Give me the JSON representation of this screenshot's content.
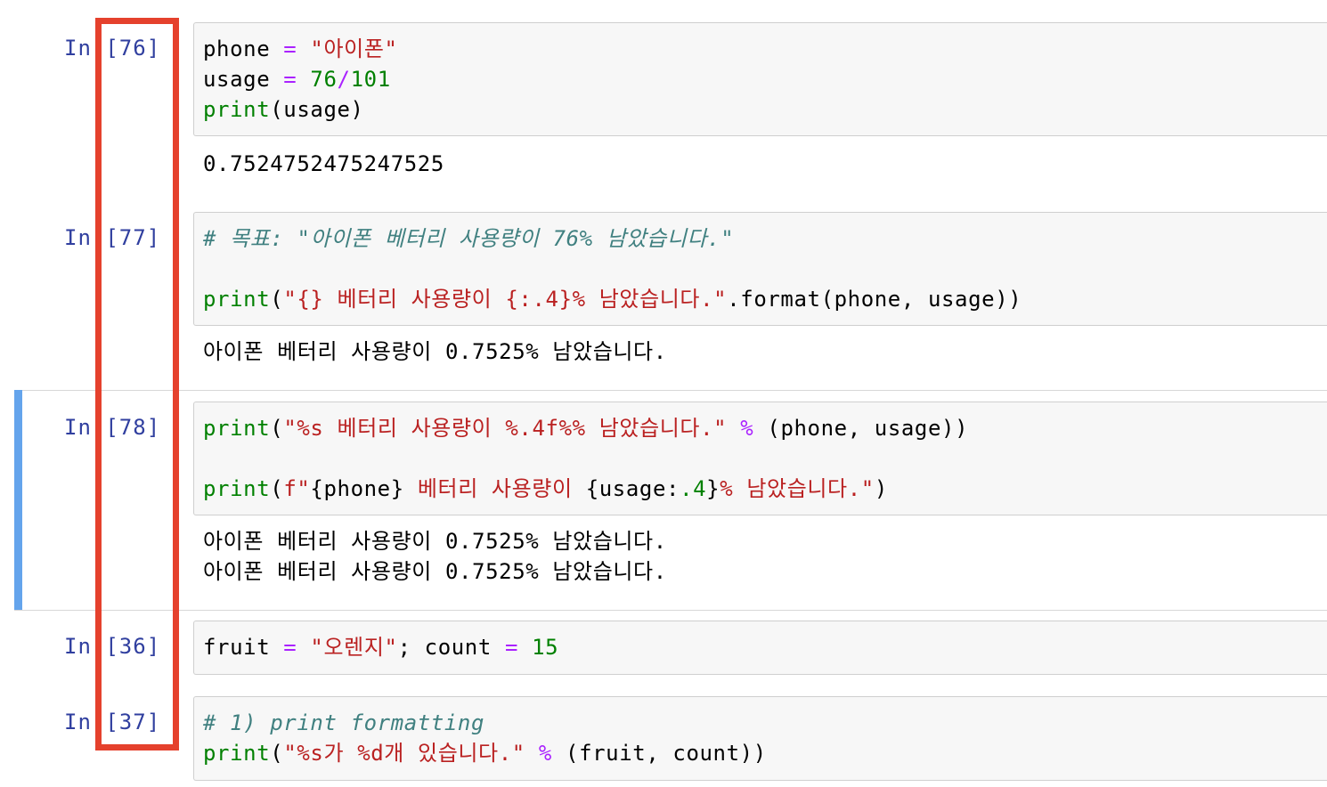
{
  "cells": [
    {
      "prompt": "In [76]",
      "lines": [
        [
          {
            "t": "phone "
          },
          {
            "t": "=",
            "c": "op"
          },
          {
            "t": " "
          },
          {
            "t": "\"아이폰\"",
            "c": "str"
          }
        ],
        [
          {
            "t": "usage "
          },
          {
            "t": "=",
            "c": "op"
          },
          {
            "t": " "
          },
          {
            "t": "76",
            "c": "num"
          },
          {
            "t": "/",
            "c": "op"
          },
          {
            "t": "101",
            "c": "num"
          }
        ],
        [
          {
            "t": "print",
            "c": "kw"
          },
          {
            "t": "(usage)"
          }
        ]
      ],
      "output": [
        "0.7524752475247525"
      ]
    },
    {
      "prompt": "In [77]",
      "lines": [
        [
          {
            "t": "# 목표: \"아이폰 베터리 사용량이 76% 남았습니다.\"",
            "c": "cm"
          }
        ],
        [],
        [
          {
            "t": "print",
            "c": "kw"
          },
          {
            "t": "("
          },
          {
            "t": "\"{} 베터리 사용량이 {:.4}% 남았습니다.\"",
            "c": "str"
          },
          {
            "t": ".format(phone, usage))"
          }
        ]
      ],
      "output": [
        "아이폰 베터리 사용량이 0.7525% 남았습니다."
      ]
    },
    {
      "prompt": "In [78]",
      "lines": [
        [
          {
            "t": "print",
            "c": "kw"
          },
          {
            "t": "("
          },
          {
            "t": "\"%s 베터리 사용량이 %.4f%% 남았습니다.\"",
            "c": "str"
          },
          {
            "t": " "
          },
          {
            "t": "%",
            "c": "op"
          },
          {
            "t": " (phone, usage))"
          }
        ],
        [],
        [
          {
            "t": "print",
            "c": "kw"
          },
          {
            "t": "("
          },
          {
            "t": "f\"",
            "c": "str"
          },
          {
            "t": "{phone}"
          },
          {
            "t": " 베터리 사용량이 ",
            "c": "str"
          },
          {
            "t": "{usage:"
          },
          {
            "t": ".4",
            "c": "num"
          },
          {
            "t": "}"
          },
          {
            "t": "% 남았습니다.\"",
            "c": "str"
          },
          {
            "t": ")"
          }
        ]
      ],
      "output": [
        "아이폰 베터리 사용량이 0.7525% 남았습니다.",
        "아이폰 베터리 사용량이 0.7525% 남았습니다."
      ]
    },
    {
      "prompt": "In [36]",
      "lines": [
        [
          {
            "t": "fruit "
          },
          {
            "t": "=",
            "c": "op"
          },
          {
            "t": " "
          },
          {
            "t": "\"오렌지\"",
            "c": "str"
          },
          {
            "t": "; count "
          },
          {
            "t": "=",
            "c": "op"
          },
          {
            "t": " "
          },
          {
            "t": "15",
            "c": "num"
          }
        ]
      ],
      "output": []
    },
    {
      "prompt": "In [37]",
      "lines": [
        [
          {
            "t": "# 1) print formatting",
            "c": "cm"
          }
        ],
        [
          {
            "t": "print",
            "c": "kw"
          },
          {
            "t": "("
          },
          {
            "t": "\"%s가 %d개 있습니다.\"",
            "c": "str"
          },
          {
            "t": " "
          },
          {
            "t": "%",
            "c": "op"
          },
          {
            "t": " (fruit, count))"
          }
        ]
      ],
      "output": []
    }
  ],
  "colors": {
    "prompt": "#303f9f",
    "keyword": "#008000",
    "operator": "#aa22ff",
    "string": "#ba2121",
    "comment": "#408080",
    "selected_bar": "#64a4ec",
    "highlight_box": "#e5412d"
  }
}
